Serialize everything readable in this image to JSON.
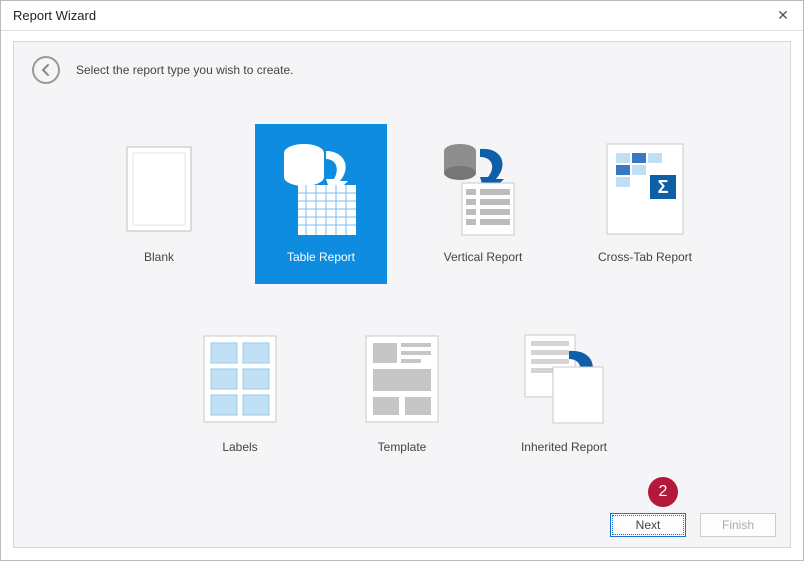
{
  "window": {
    "title": "Report Wizard"
  },
  "instruction": "Select the report type you wish to create.",
  "tiles": {
    "blank": "Blank",
    "table": "Table Report",
    "vertical": "Vertical Report",
    "crosstab": "Cross-Tab Report",
    "labels": "Labels",
    "template": "Template",
    "inherited": "Inherited Report"
  },
  "selected": "table",
  "marker": "2",
  "buttons": {
    "next": "Next",
    "finish": "Finish"
  }
}
